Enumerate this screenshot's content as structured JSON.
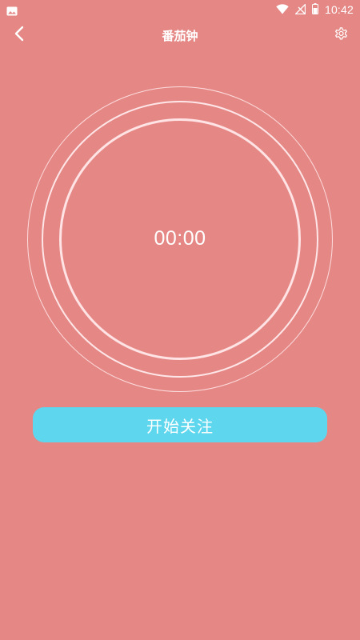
{
  "status_bar": {
    "time": "10:42",
    "icons": [
      "image-icon",
      "wifi-icon",
      "no-signal-icon",
      "battery-icon"
    ]
  },
  "toolbar": {
    "title": "番茄钟",
    "back_icon": "chevron-left-icon",
    "settings_icon": "gear-icon"
  },
  "timer": {
    "display": "00:00"
  },
  "start_button": {
    "label": "开始关注"
  },
  "colors": {
    "background": "#E58885",
    "accent_button": "#5DD6EE",
    "ring": "#FFE3E5",
    "text": "#FFFFFF"
  }
}
